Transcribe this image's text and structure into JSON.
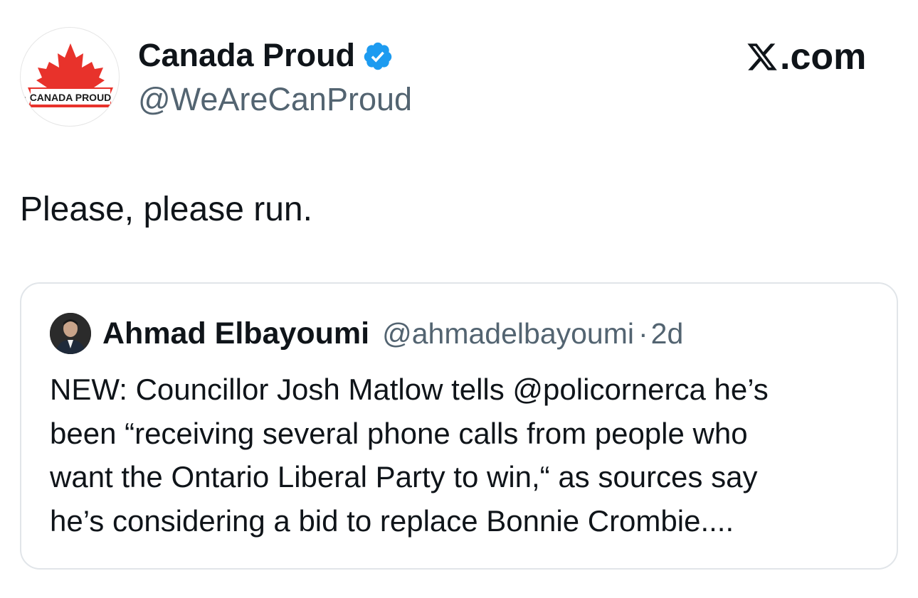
{
  "tweet": {
    "author_name": "Canada Proud",
    "author_handle": "@WeAreCanProud",
    "verified": true,
    "badge_color": "#1d9bf0",
    "avatar_text": "CANADA PROUD",
    "brand_color": "#e8322b",
    "text": "Please, please run."
  },
  "watermark": {
    "label": ".com",
    "icon": "x-logo-icon"
  },
  "quoted_tweet": {
    "author_name": "Ahmad Elbayoumi",
    "author_handle": "@ahmadelbayoumi",
    "separator": "·",
    "time": "2d",
    "body_lines": [
      "NEW: Councillor Josh Matlow tells @policornerca he’s",
      "been “receiving several phone calls from people who",
      "want the Ontario Liberal Party to win,“ as sources say",
      "he’s considering a bid to replace Bonnie Crombie...."
    ]
  }
}
